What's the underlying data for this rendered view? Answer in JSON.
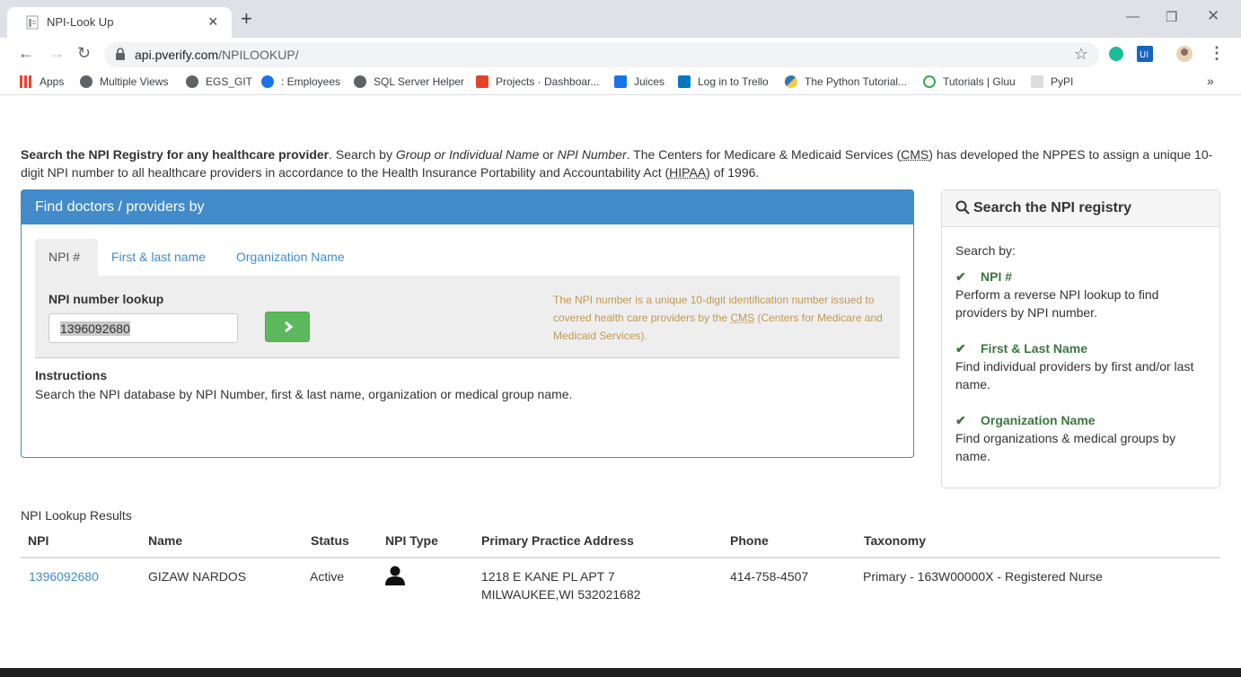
{
  "browser": {
    "tab_title": "NPI-Look Up",
    "tab_close": "×",
    "new_tab": "+",
    "url_host": "api.pverify.com",
    "url_path": "/NPILOOKUP/",
    "star": "☆",
    "bookmarks": [
      {
        "label": "Apps",
        "color": "#ea4335"
      },
      {
        "label": "Multiple Views",
        "color": "#5f6368"
      },
      {
        "label": "EGS_GIT",
        "color": "#5f6368"
      },
      {
        "label": ": Employees",
        "color": "#1a73e8"
      },
      {
        "label": "SQL Server Helper",
        "color": "#5f6368"
      },
      {
        "label": "Projects · Dashboar...",
        "color": "#e24329"
      },
      {
        "label": "Juices",
        "color": "#1a73e8"
      },
      {
        "label": "Log in to Trello",
        "color": "#0079bf"
      },
      {
        "label": "The Python Tutorial...",
        "color": "#f7c948"
      },
      {
        "label": "Tutorials | Gluu",
        "color": "#34a853"
      },
      {
        "label": "PyPI",
        "color": "#dadce0"
      }
    ],
    "bookmarks_more": "»"
  },
  "intro": {
    "b1": "Search the NPI Registry for any healthcare provider",
    "t1": ". Search by ",
    "i1": "Group or Individual Name",
    "t2": " or ",
    "i2": "NPI Number",
    "t3": ". The Centers for Medicare & Medicaid Services (",
    "cms": "CMS",
    "t4": ") has developed the NPPES to assign a unique 10-digit NPI number to all healthcare providers in accordance to the Health Insurance Portability and Accountability Act (",
    "hipaa": "HIPAA",
    "t5": ") of 1996."
  },
  "finder": {
    "heading": "Find doctors / providers by",
    "tabs": [
      "NPI #",
      "First & last name",
      "Organization Name"
    ],
    "lookup_label": "NPI number lookup",
    "npi_value": "1396092680",
    "help1": "The NPI number is a unique 10-digit identification number issued to covered health care providers by the ",
    "help_cms": "CMS",
    "help2": " (Centers for Medicare and Medicaid Services).",
    "instructions_title": "Instructions",
    "instructions_text": "Search the NPI database by NPI Number, first & last name, organization or medical group name."
  },
  "sidebar": {
    "heading": "Search the NPI registry",
    "search_by": "Search by:",
    "options": [
      {
        "title": "NPI #",
        "desc": "Perform a reverse NPI lookup to find providers by NPI number."
      },
      {
        "title": "First & Last Name",
        "desc": "Find individual providers by first and/or last name."
      },
      {
        "title": "Organization Name",
        "desc": "Find organizations & medical groups by name."
      }
    ]
  },
  "results": {
    "title": "NPI Lookup Results",
    "columns": [
      "NPI",
      "Name",
      "Status",
      "NPI Type",
      "Primary Practice Address",
      "Phone",
      "Taxonomy"
    ],
    "rows": [
      {
        "npi": "1396092680",
        "name": "GIZAW NARDOS",
        "status": "Active",
        "type_icon": "person-icon",
        "address1": "1218 E KANE PL APT 7",
        "address2": "MILWAUKEE,WI 532021682",
        "phone": "414-758-4507",
        "taxonomy": "Primary - 163W00000X - Registered Nurse"
      }
    ]
  }
}
